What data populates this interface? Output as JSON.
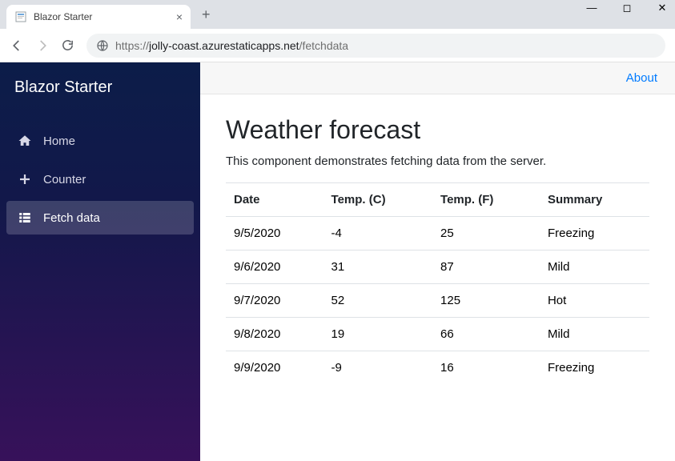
{
  "browser": {
    "tab_title": "Blazor Starter",
    "url_prefix": "https://",
    "url_host": "jolly-coast.azurestaticapps.net",
    "url_path": "/fetchdata"
  },
  "sidebar": {
    "brand": "Blazor Starter",
    "items": [
      {
        "label": "Home",
        "icon": "home",
        "active": false
      },
      {
        "label": "Counter",
        "icon": "plus",
        "active": false
      },
      {
        "label": "Fetch data",
        "icon": "list",
        "active": true
      }
    ]
  },
  "topbar": {
    "about_label": "About"
  },
  "page": {
    "title": "Weather forecast",
    "lead": "This component demonstrates fetching data from the server."
  },
  "table": {
    "headers": [
      "Date",
      "Temp. (C)",
      "Temp. (F)",
      "Summary"
    ],
    "rows": [
      {
        "date": "9/5/2020",
        "tc": "-4",
        "tf": "25",
        "summary": "Freezing"
      },
      {
        "date": "9/6/2020",
        "tc": "31",
        "tf": "87",
        "summary": "Mild"
      },
      {
        "date": "9/7/2020",
        "tc": "52",
        "tf": "125",
        "summary": "Hot"
      },
      {
        "date": "9/8/2020",
        "tc": "19",
        "tf": "66",
        "summary": "Mild"
      },
      {
        "date": "9/9/2020",
        "tc": "-9",
        "tf": "16",
        "summary": "Freezing"
      }
    ]
  }
}
